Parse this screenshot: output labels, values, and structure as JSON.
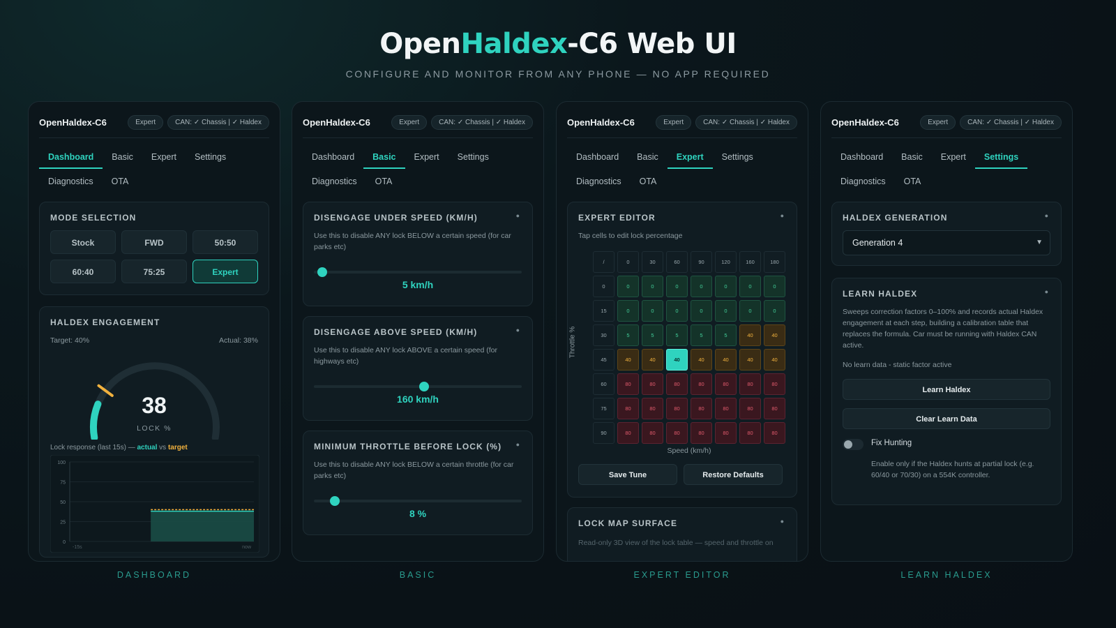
{
  "hero": {
    "title_a": "Open",
    "title_b": "Haldex",
    "title_c": "-C6 Web UI",
    "subtitle": "CONFIGURE AND MONITOR FROM ANY PHONE — NO APP REQUIRED"
  },
  "common": {
    "app_name": "OpenHaldex-C6",
    "mode_pill": "Expert",
    "can_pill": "CAN: ✓ Chassis | ✓ Haldex",
    "tabs_row1": [
      "Dashboard",
      "Basic",
      "Expert",
      "Settings"
    ],
    "tabs_row2": [
      "Diagnostics",
      "OTA"
    ]
  },
  "captions": [
    "DASHBOARD",
    "BASIC",
    "EXPERT EDITOR",
    "LEARN HALDEX"
  ],
  "dashboard": {
    "mode_title": "MODE SELECTION",
    "modes": [
      "Stock",
      "FWD",
      "50:50",
      "60:40",
      "75:25",
      "Expert"
    ],
    "active_mode": "Expert",
    "engagement_title": "HALDEX ENGAGEMENT",
    "target_label": "Target: 40%",
    "actual_label": "Actual: 38%",
    "gauge_value": "38",
    "gauge_unit": "LOCK %",
    "gauge_fraction": 0.38,
    "target_fraction": 0.4,
    "response_prefix": "Lock response (last 15s) — ",
    "response_actual": "actual",
    "response_vs": " vs ",
    "response_target": "target",
    "chart_yticks": [
      "100",
      "75",
      "50",
      "25",
      "0"
    ],
    "chart_xticks": [
      "-15s",
      "now"
    ],
    "chart_target": 40,
    "chart_actual": 38
  },
  "basic": {
    "sections": [
      {
        "title": "DISENGAGE UNDER SPEED (KM/H)",
        "desc": "Use this to disable ANY lock BELOW a certain speed (for car parks etc)",
        "value": "5 km/h",
        "fraction": 0.04
      },
      {
        "title": "DISENGAGE ABOVE SPEED (KM/H)",
        "desc": "Use this to disable ANY lock ABOVE a certain speed (for highways etc)",
        "value": "160 km/h",
        "fraction": 0.53
      },
      {
        "title": "MINIMUM THROTTLE BEFORE LOCK (%)",
        "desc": "Use this to disable ANY lock BELOW a certain throttle (for car parks etc)",
        "value": "8 %",
        "fraction": 0.1
      }
    ]
  },
  "expert": {
    "title": "EXPERT EDITOR",
    "subtitle": "Tap cells to edit lock percentage",
    "corner": "/",
    "speeds": [
      "0",
      "30",
      "60",
      "90",
      "120",
      "160",
      "180"
    ],
    "throttles": [
      "0",
      "15",
      "30",
      "45",
      "60",
      "75",
      "90"
    ],
    "rows": [
      [
        "0",
        "0",
        "0",
        "0",
        "0",
        "0",
        "0"
      ],
      [
        "0",
        "0",
        "0",
        "0",
        "0",
        "0",
        "0"
      ],
      [
        "5",
        "5",
        "5",
        "5",
        "5",
        "40",
        "40"
      ],
      [
        "40",
        "40",
        "40",
        "40",
        "40",
        "40",
        "40"
      ],
      [
        "80",
        "80",
        "80",
        "80",
        "80",
        "80",
        "80"
      ],
      [
        "80",
        "80",
        "80",
        "80",
        "80",
        "80",
        "80"
      ],
      [
        "80",
        "80",
        "80",
        "80",
        "80",
        "80",
        "80"
      ]
    ],
    "y_axis": "Throttle %",
    "x_axis": "Speed (km/h)",
    "save_label": "Save Tune",
    "restore_label": "Restore Defaults",
    "surface_title": "LOCK MAP SURFACE",
    "surface_desc": "Read-only 3D view of the lock table — speed and throttle on"
  },
  "settings": {
    "generation_title": "HALDEX GENERATION",
    "generation_value": "Generation 4",
    "learn_title": "LEARN HALDEX",
    "learn_desc": "Sweeps correction factors 0–100% and records actual Haldex engagement at each step, building a calibration table that replaces the formula. Car must be running with Haldex CAN active.",
    "learn_status": "No learn data - static factor active",
    "learn_button": "Learn Haldex",
    "clear_button": "Clear Learn Data",
    "fix_label": "Fix Hunting",
    "fix_desc": "Enable only if the Haldex hunts at partial lock (e.g. 60/40 or 70/30) on a 554K controller."
  },
  "colors": {
    "accent": "#2fd3bf",
    "target": "#f2b23e",
    "green": "#43d09a",
    "amber": "#f2b23e",
    "red": "#e05a6c"
  }
}
